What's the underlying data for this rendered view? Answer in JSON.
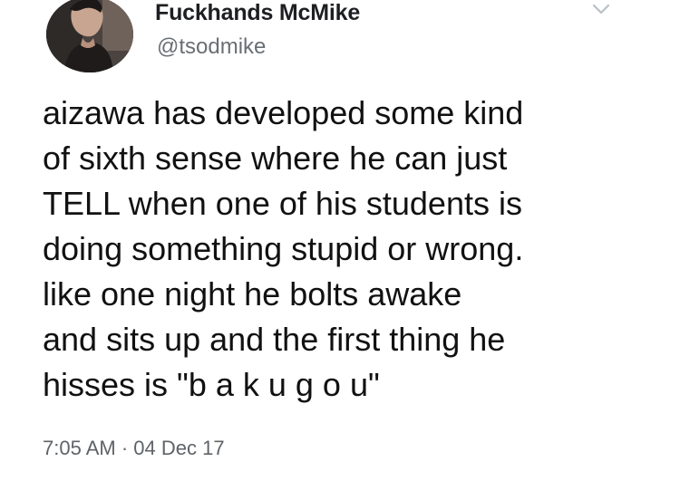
{
  "tweet": {
    "author": {
      "display_name": "Fuckhands McMike",
      "handle": "@tsodmike",
      "avatar_icon": "user-avatar-photo"
    },
    "menu_icon": "chevron-down-icon",
    "text_lines": [
      "aizawa has developed some kind",
      "of sixth sense where he can just",
      "TELL when one of his students is",
      "doing something stupid or wrong.",
      "like one night he bolts awake",
      "and sits up and the first thing he",
      "hisses is \"b a k u g o u\""
    ],
    "timestamp": "7:05 AM · 04 Dec 17"
  },
  "colors": {
    "background": "#ffffff",
    "text": "#111111",
    "secondary": "#6a6f74",
    "chevron": "#b9c0c6"
  }
}
